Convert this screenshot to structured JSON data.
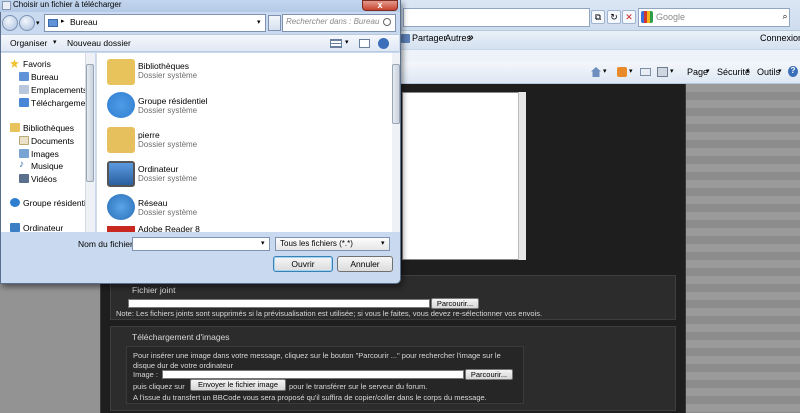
{
  "browser": {
    "search_placeholder": "Google",
    "favorites_bar": {
      "share_label": "Partager",
      "more_label": "Autres",
      "more_chevron": "»",
      "connexion_label": "Connexion"
    },
    "command_bar": {
      "page_label": "Page",
      "security_label": "Sécurité",
      "tools_label": "Outils",
      "dropdown_glyph": "▾",
      "help_glyph": "?"
    },
    "icons": [
      "home-icon",
      "rss-icon",
      "mail-icon",
      "print-icon",
      "refresh-icon",
      "stop-icon",
      "close-icon"
    ]
  },
  "dialog": {
    "title": "Choisir un fichier à télécharger",
    "path": "Bureau",
    "path_separator": "▸",
    "search_placeholder": "Rechercher dans : Bureau",
    "toolbar": {
      "organize_label": "Organiser",
      "new_folder_label": "Nouveau dossier"
    },
    "nav": {
      "favorites_header": "Favoris",
      "favorites": [
        "Bureau",
        "Emplacements ré",
        "Téléchargements"
      ],
      "libraries_header": "Bibliothèques",
      "libraries": [
        "Documents",
        "Images",
        "Musique",
        "Vidéos"
      ],
      "homegroup": "Groupe résidentiel",
      "computer": "Ordinateur"
    },
    "items": [
      {
        "name": "Bibliothèques",
        "type": "Dossier système",
        "icon": "libraries-icon",
        "color": "#e8c25a"
      },
      {
        "name": "Groupe résidentiel",
        "type": "Dossier système",
        "icon": "homegroup-icon",
        "color": "#2f7fd0"
      },
      {
        "name": "pierre",
        "type": "Dossier système",
        "icon": "user-folder-icon",
        "color": "#e6c05c"
      },
      {
        "name": "Ordinateur",
        "type": "Dossier système",
        "icon": "computer-icon",
        "color": "#3c7ec4"
      },
      {
        "name": "Réseau",
        "type": "Dossier système",
        "icon": "network-icon",
        "color": "#3a8ad6"
      },
      {
        "name": "Adobe Reader 8",
        "type": "",
        "icon": "adobe-reader-icon",
        "color": "#c8281e"
      }
    ],
    "filename_label": "Nom du fichier :",
    "filename_value": "",
    "filetype_value": "Tous les fichiers (*.*)",
    "open_label": "Ouvrir",
    "cancel_label": "Annuler",
    "close_glyph": "x"
  },
  "page": {
    "attachment": {
      "title": "Fichier joint",
      "browse_label": "Parcourir...",
      "note": "Note: Les fichiers joints sont supprimés si la prévisualisation est utilisée; si vous le faites, vous devez re-sélectionner vos envois."
    },
    "image_upload": {
      "title": "Téléchargement d'images",
      "intro_line1": "Pour insérer une image dans votre message, cliquez sur le bouton \"Parcourir ...\" pour rechercher l'image sur le",
      "intro_line2": "disque dur de votre ordinateur",
      "image_label": "Image :",
      "browse_label": "Parcourir...",
      "then_click": "puis cliquez sur",
      "send_label": "Envoyer le fichier image",
      "then_text": "pour le transférer sur le serveur du forum.",
      "footer": "A l'issue du transfert un BBCode vous sera proposé qu'il suffira de copier/coller dans le corps du message."
    }
  },
  "colors": {
    "dialog_bg": "#c9daf0",
    "forum_bg": "#1e1e1e",
    "close_button": "#c7432f"
  }
}
